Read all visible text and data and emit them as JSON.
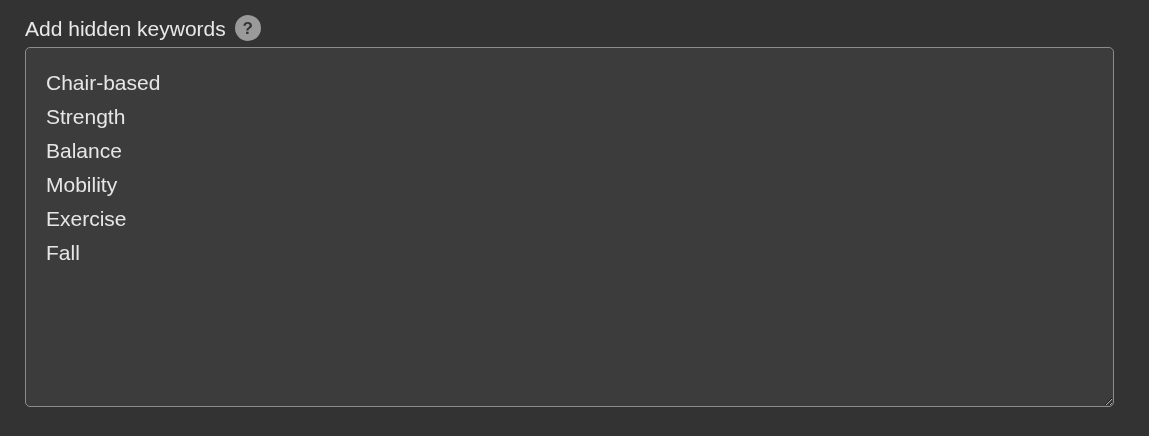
{
  "field": {
    "label": "Add hidden keywords",
    "help_icon": "?",
    "keywords": [
      "Chair-based",
      "Strength",
      "Balance",
      "Mobility",
      "Exercise",
      "Fall"
    ]
  }
}
